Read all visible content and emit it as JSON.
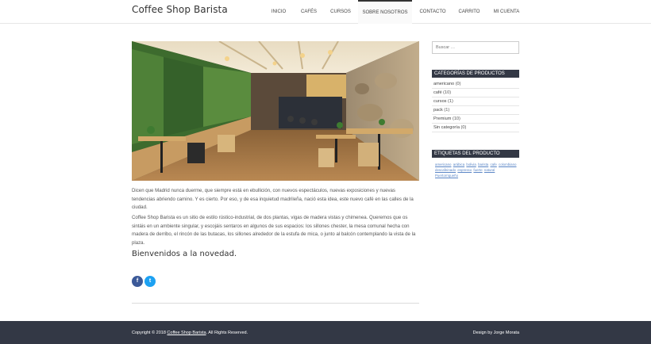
{
  "site": {
    "title": "Coffee Shop Barista"
  },
  "nav": {
    "items": [
      {
        "label": "INICIO",
        "active": false
      },
      {
        "label": "CAFÉS",
        "active": false
      },
      {
        "label": "CURSOS",
        "active": false
      },
      {
        "label": "SOBRE NOSOTROS",
        "active": true
      },
      {
        "label": "CONTACTO",
        "active": false
      },
      {
        "label": "CARRITO",
        "active": false
      },
      {
        "label": "MI CUENTA",
        "active": false
      }
    ]
  },
  "content": {
    "paragraph1": "Dicen que Madrid nunca duerme, que siempre está en ebullición, con nuevos espectáculos, nuevas exposiciones y nuevas tendencias abriendo camino. Y es cierto. Por eso, y de esa inquietud madrileña, nació esta idea, este nuevo café en las calles de la ciudad.",
    "paragraph2": "Coffee Shop Barista es un sitio de estilo rústico-industrial, de dos plantas, vigas de madera vistas y chimenea. Queremos que os sintáis en un ambiente singular, y escojáis sentaros en algunos de sus espacios: los sillones chester, la mesa comunal hecha con madera de derribo, el rincón de las butacas, los sillones alrededor de la estufa de mica, o junto al balcón contemplando la vista de la plaza.",
    "welcome": "Bienvenidos a la novedad.",
    "share": {
      "facebook_icon": "f",
      "twitter_icon": "t"
    }
  },
  "sidebar": {
    "search_placeholder": "Buscar …",
    "categories_title": "CATEGORÍAS DE PRODUCTOS",
    "categories": [
      {
        "name": "americano",
        "count": "(0)"
      },
      {
        "name": "café",
        "count": "(10)"
      },
      {
        "name": "cursos",
        "count": "(1)"
      },
      {
        "name": "pack",
        "count": "(1)"
      },
      {
        "name": "Premium",
        "count": "(10)"
      },
      {
        "name": "Sin categoría",
        "count": "(0)"
      }
    ],
    "tags_title": "ETIQUETAS DEL PRODUCTO",
    "tags": [
      "americano",
      "arábica",
      "bolivia",
      "barista",
      "cafe",
      "colombiano",
      "descafeinado",
      "espresso",
      "fuerte",
      "natural",
      "Puertorriqueño"
    ]
  },
  "footer": {
    "copyright_prefix": "Copyright © 2018",
    "copyright_link": "Coffee Shop Barista",
    "copyright_suffix": ". All Rights Reserved.",
    "design": "Design by Jorge Morata"
  },
  "colors": {
    "dark": "#333845",
    "link": "#5b86c6",
    "facebook": "#3b5998",
    "twitter": "#1da1f2"
  }
}
